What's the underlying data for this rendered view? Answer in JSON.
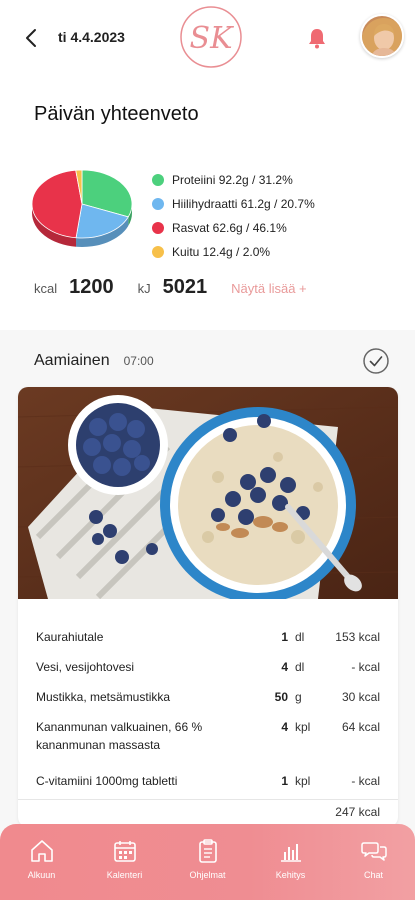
{
  "header": {
    "date": "ti 4.4.2023",
    "logo_text": "SK"
  },
  "summary": {
    "title": "Päivän yhteenveto",
    "legend": [
      {
        "label": "Proteiini 92.2g / 31.2%",
        "color": "#4cd07d"
      },
      {
        "label": "Hiilihydraatti 61.2g / 20.7%",
        "color": "#6fb7ef"
      },
      {
        "label": "Rasvat 62.6g / 46.1%",
        "color": "#e8334a"
      },
      {
        "label": "Kuitu 12.4g / 2.0%",
        "color": "#f7c04a"
      }
    ],
    "kcal_unit": "kcal",
    "kcal_value": "1200",
    "kj_unit": "kJ",
    "kj_value": "5021",
    "more_label": "Näytä lisää +"
  },
  "meal": {
    "name": "Aamiainen",
    "time": "07:00",
    "foods": [
      {
        "name": "Kaurahiutale",
        "qty": "1",
        "unit": "dl",
        "kcal": "153 kcal"
      },
      {
        "name": "Vesi, vesijohtovesi",
        "qty": "4",
        "unit": "dl",
        "kcal": "- kcal"
      },
      {
        "name": "Mustikka, metsämustikka",
        "qty": "50",
        "unit": "g",
        "kcal": "30 kcal"
      },
      {
        "name": "Kananmunan valkuainen, 66 % kananmunan massasta",
        "qty": "4",
        "unit": "kpl",
        "kcal": "64 kcal"
      },
      {
        "name": "C-vitamiini 1000mg tabletti",
        "qty": "1",
        "unit": "kpl",
        "kcal": "- kcal"
      }
    ],
    "total": "247 kcal"
  },
  "nav": {
    "items": [
      {
        "label": "Alkuun",
        "icon": "home-icon"
      },
      {
        "label": "Kalenteri",
        "icon": "calendar-icon"
      },
      {
        "label": "Ohjelmat",
        "icon": "clipboard-icon"
      },
      {
        "label": "Kehitys",
        "icon": "chart-icon"
      },
      {
        "label": "Chat",
        "icon": "chat-icon"
      }
    ]
  },
  "chart_data": {
    "type": "pie",
    "categories": [
      "Proteiini",
      "Hiilihydraatti",
      "Rasvat",
      "Kuitu"
    ],
    "values": [
      31.2,
      20.7,
      46.1,
      2.0
    ],
    "colors": [
      "#4cd07d",
      "#6fb7ef",
      "#e8334a",
      "#f7c04a"
    ]
  }
}
